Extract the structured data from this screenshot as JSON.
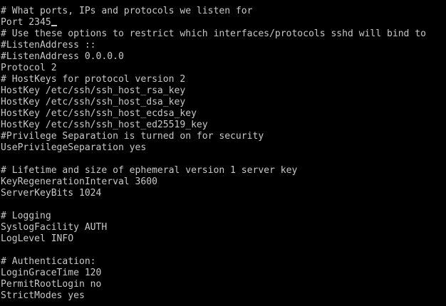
{
  "terminal": {
    "lines": [
      "# What ports, IPs and protocols we listen for",
      "Port 2345",
      "# Use these options to restrict which interfaces/protocols sshd will bind to",
      "#ListenAddress ::",
      "#ListenAddress 0.0.0.0",
      "Protocol 2",
      "# HostKeys for protocol version 2",
      "HostKey /etc/ssh/ssh_host_rsa_key",
      "HostKey /etc/ssh/ssh_host_dsa_key",
      "HostKey /etc/ssh/ssh_host_ecdsa_key",
      "HostKey /etc/ssh/ssh_host_ed25519_key",
      "#Privilege Separation is turned on for security",
      "UsePrivilegeSeparation yes",
      "",
      "# Lifetime and size of ephemeral version 1 server key",
      "KeyRegenerationInterval 3600",
      "ServerKeyBits 1024",
      "",
      "# Logging",
      "SyslogFacility AUTH",
      "LogLevel INFO",
      "",
      "# Authentication:",
      "LoginGraceTime 120",
      "PermitRootLogin no",
      "StrictModes yes"
    ],
    "cursor_line": 1
  },
  "colors": {
    "background": "#000000",
    "foreground": "#c8c8c8"
  }
}
